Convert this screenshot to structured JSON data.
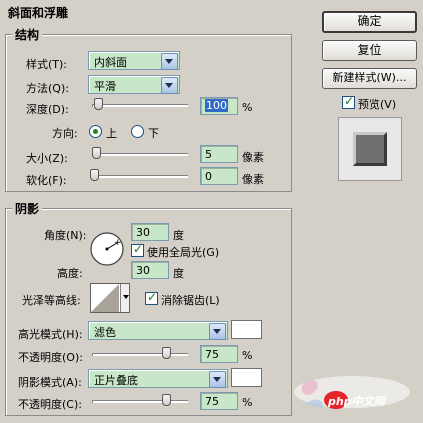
{
  "dialog": {
    "section_title": "斜面和浮雕",
    "structure": {
      "legend": "结构",
      "style_label": "样式(T):",
      "style_value": "内斜面",
      "technique_label": "方法(Q):",
      "technique_value": "平滑",
      "depth_label": "深度(D):",
      "depth_value": "100",
      "depth_unit": "%",
      "depth_level_percent": 2,
      "direction_label": "方向:",
      "direction_up": "上",
      "direction_down": "下",
      "direction_selected": "上",
      "size_label": "大小(Z):",
      "size_value": "5",
      "size_unit": "像素",
      "soften_label": "软化(F):",
      "soften_value": "0",
      "soften_unit": "像素"
    },
    "shading": {
      "legend": "阴影",
      "angle_label": "角度(N):",
      "angle_value": "30",
      "angle_unit": "度",
      "global_light_label": "使用全局光(G)",
      "global_light_checked": true,
      "altitude_label": "高度:",
      "altitude_value": "30",
      "altitude_unit": "度",
      "gloss_contour_label": "光泽等高线:",
      "anti_aliased_label": "消除锯齿(L)",
      "anti_aliased_checked": true,
      "highlight_mode_label": "高光模式(H):",
      "highlight_mode_value": "滤色",
      "highlight_color": "#ffffff",
      "highlight_opacity_label": "不透明度(O):",
      "highlight_opacity_value": "75",
      "highlight_opacity_unit": "%",
      "shadow_mode_label": "阴影模式(A):",
      "shadow_mode_value": "正片叠底",
      "shadow_color": "#ffffff",
      "shadow_opacity_label": "不透明度(C):",
      "shadow_opacity_value": "75",
      "shadow_opacity_unit": "%"
    }
  },
  "buttons": {
    "ok": "确定",
    "reset": "复位",
    "new_style": "新建样式(W)...",
    "preview_label": "预览(V)",
    "preview_checked": true
  },
  "watermark": {
    "text": "php中文网"
  }
}
